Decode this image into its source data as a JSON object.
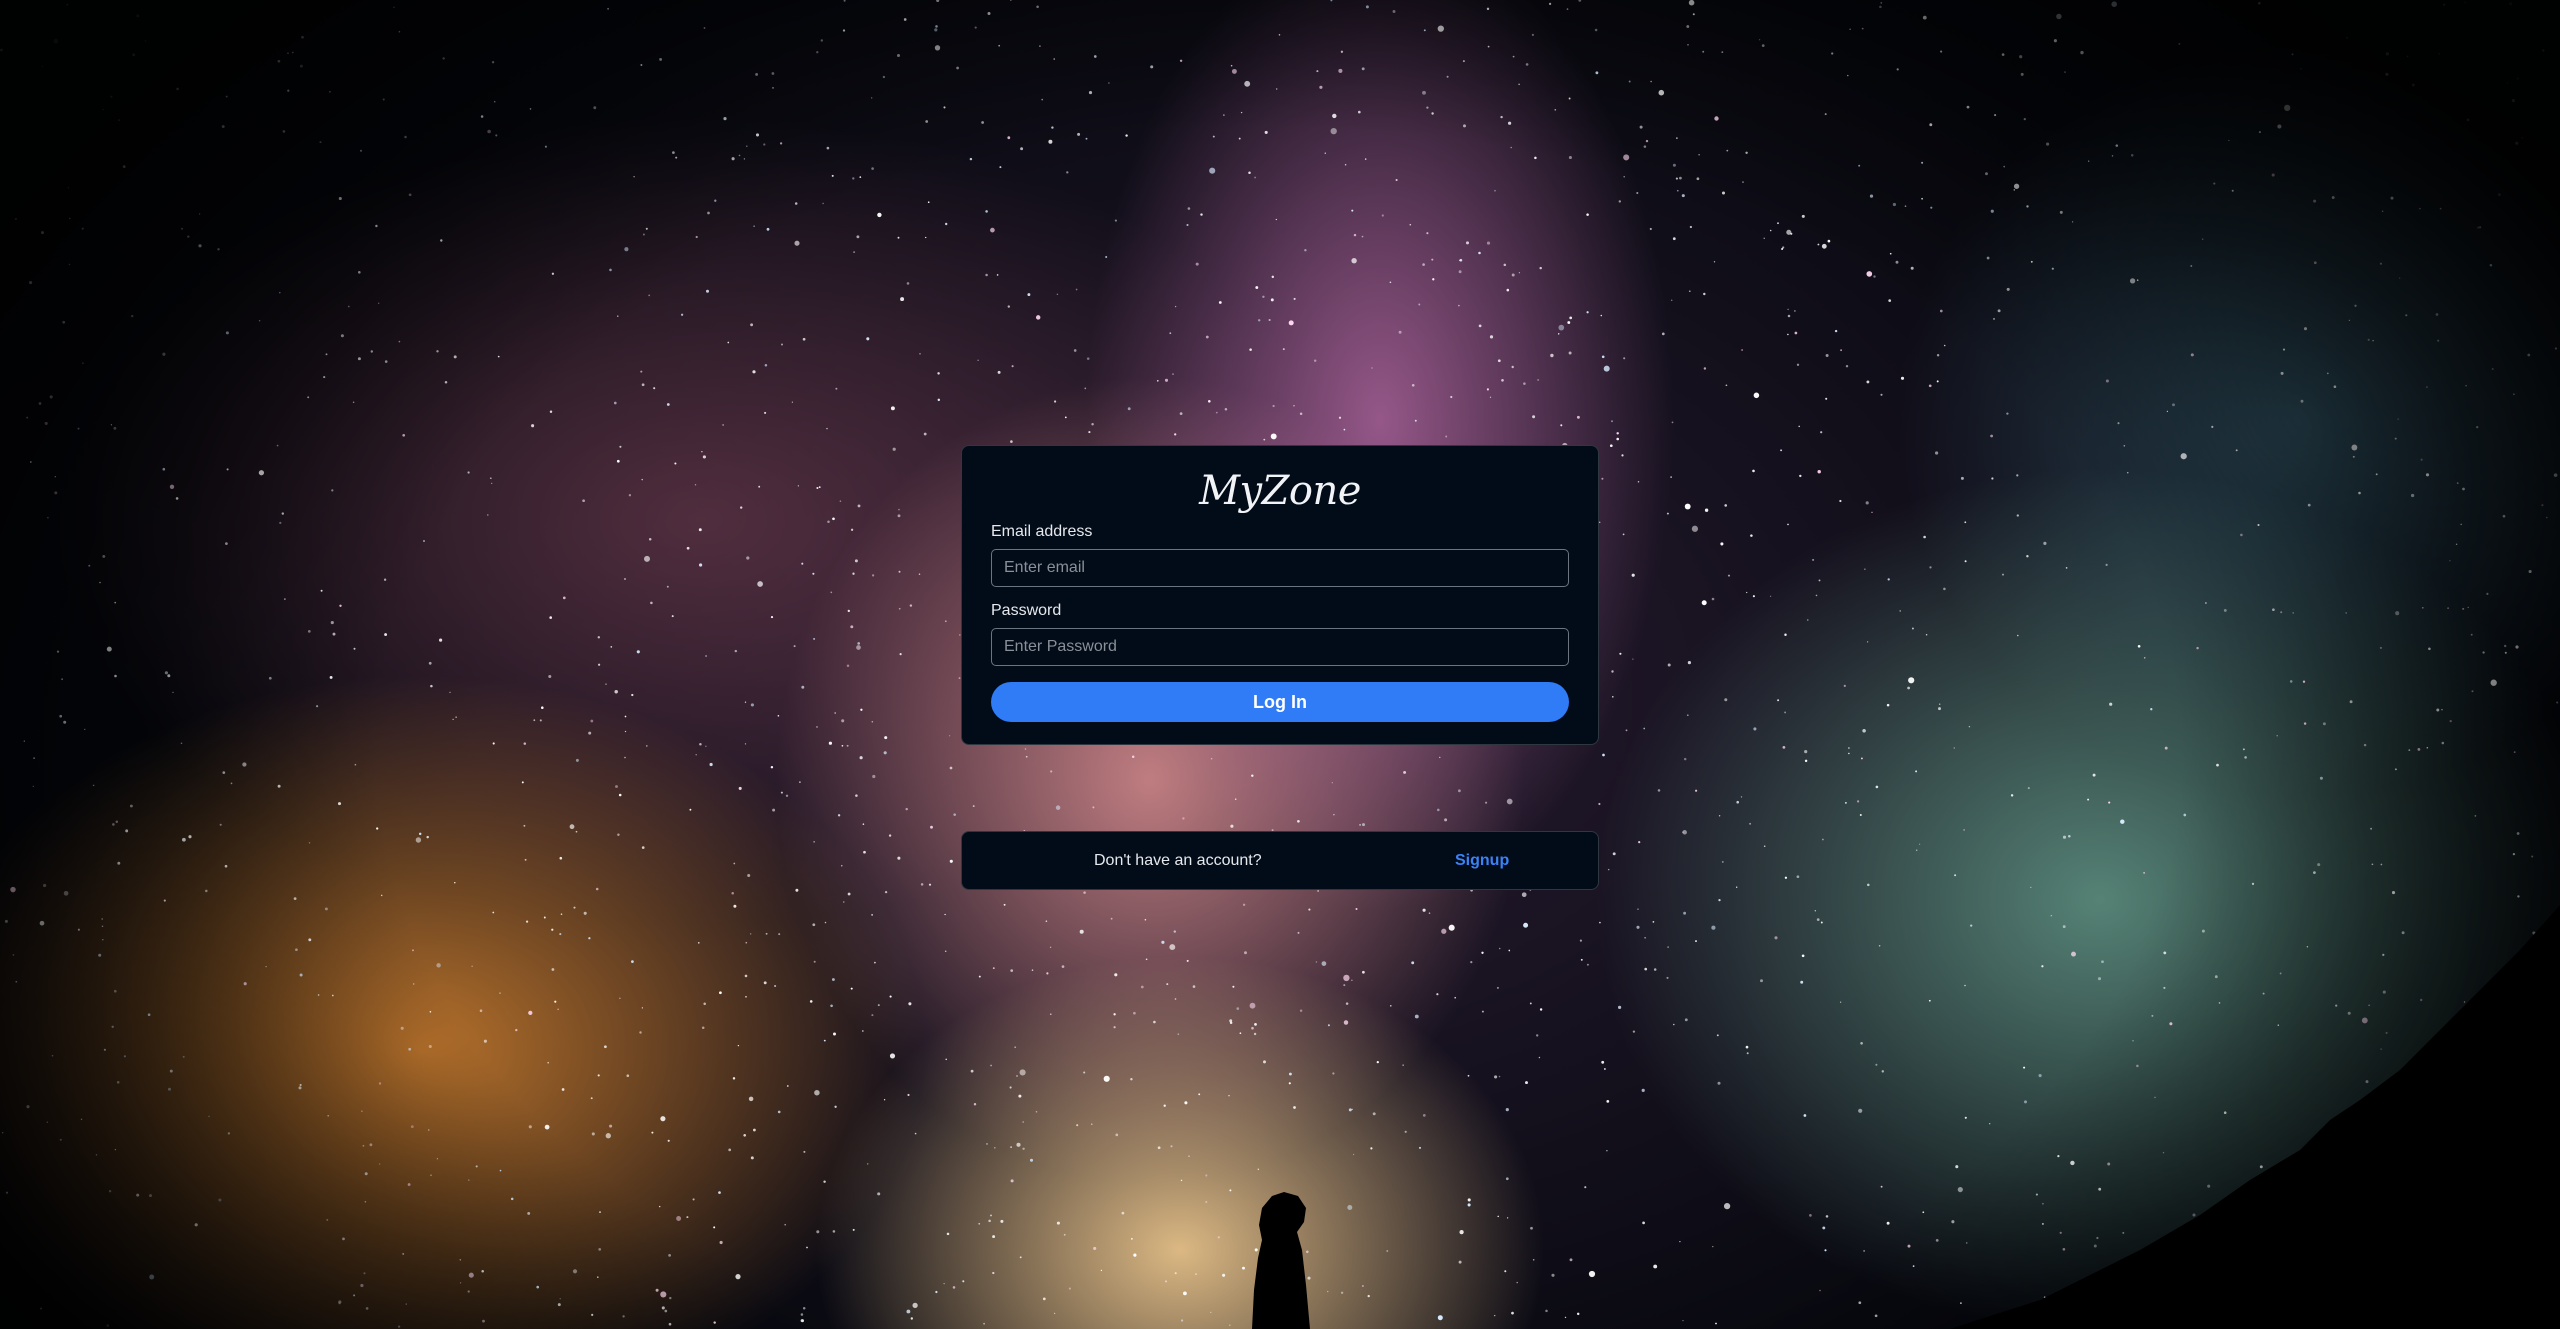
{
  "background": {
    "description_icon": "night-sky-image",
    "accent_colors": [
      "#05070d",
      "#d68430",
      "#6eaa96",
      "#be6eaa"
    ]
  },
  "login_card": {
    "brand": "MyZone",
    "email_label": "Email address",
    "email_placeholder": "Enter email",
    "email_value": "",
    "password_label": "Password",
    "password_placeholder": "Enter Password",
    "password_value": "",
    "login_button": "Log In",
    "button_color": "#2f7cf6"
  },
  "signup_bar": {
    "prompt": "Don't have an account?",
    "link": "Signup",
    "link_color": "#3b82f6"
  }
}
